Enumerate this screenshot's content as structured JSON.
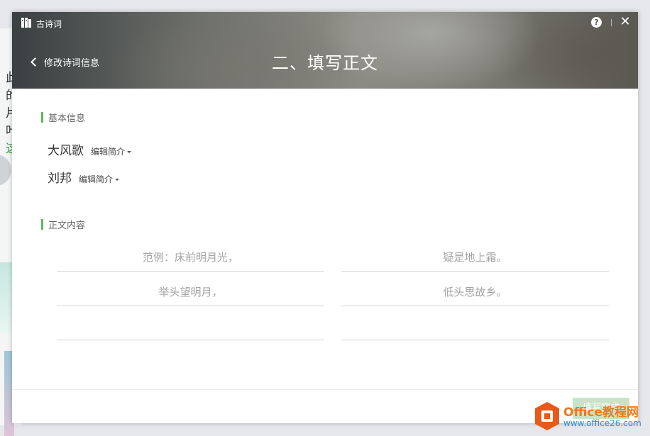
{
  "background_app": {
    "visible_chars": [
      "此",
      "的",
      "片",
      "叶",
      "这"
    ],
    "accent_color": "#3e9a4d"
  },
  "window": {
    "app_title": "古诗词",
    "app_icon": "book-icon",
    "help_icon": "help-bubble-icon",
    "help_glyph": "?",
    "close_icon": "close-icon",
    "close_glyph": "✕"
  },
  "header": {
    "back_label": "修改诗词信息",
    "page_title": "二、填写正文"
  },
  "basic_info": {
    "section_title": "基本信息",
    "title_value": "大风歌",
    "title_edit_label": "编辑简介",
    "author_value": "刘邦",
    "author_edit_label": "编辑简介"
  },
  "content": {
    "section_title": "正文内容",
    "lines": [
      {
        "value": "",
        "placeholder": "范例：床前明月光，"
      },
      {
        "value": "",
        "placeholder": "疑是地上霜。"
      },
      {
        "value": "",
        "placeholder": "举头望明月，"
      },
      {
        "value": "",
        "placeholder": "低头思故乡。"
      },
      {
        "value": "",
        "placeholder": ""
      },
      {
        "value": "",
        "placeholder": ""
      }
    ]
  },
  "footer": {
    "complete_label": "填写完成"
  },
  "watermark": {
    "brand": "Office教程网",
    "url": "www.office26.com",
    "logo_color": "#e8591a"
  },
  "colors": {
    "accent_green": "#5cb85c",
    "button_disabled": "#c7e4c9"
  }
}
